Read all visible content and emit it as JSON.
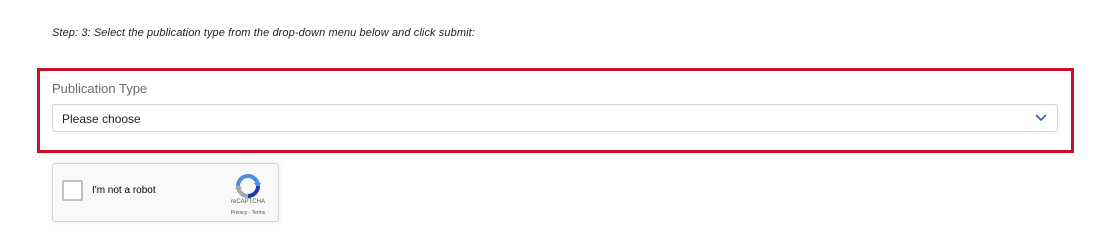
{
  "instruction": "Step: 3: Select the publication type from the drop-down menu below and click submit:",
  "publication_type": {
    "label": "Publication Type",
    "selected": "Please choose"
  },
  "recaptcha": {
    "checkbox_label": "I'm not a robot",
    "brand": "reCAPTCHA",
    "privacy": "Privacy",
    "separator": " - ",
    "terms": "Terms"
  },
  "colors": {
    "highlight": "#c8102e",
    "chevron": "#3b5da8"
  }
}
